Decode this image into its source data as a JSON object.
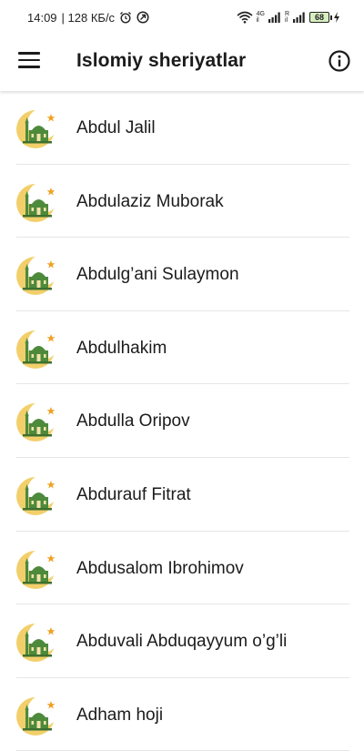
{
  "status_bar": {
    "time": "14:09",
    "network_speed": "| 128 КБ/с",
    "battery_level": "68",
    "signal_1_label_top": "4G",
    "signal_1_label_bottom": "il",
    "signal_2_label_top": "R",
    "signal_2_label_bottom": "il"
  },
  "app_bar": {
    "title": "Islomiy sheriyatlar"
  },
  "colors": {
    "moon": "#f2cf6a",
    "mosque": "#4d8a3c",
    "star": "#f0a020",
    "divider": "#e6e6e6"
  },
  "list": {
    "items": [
      {
        "label": "Abdul Jalil",
        "icon": "mosque-crescent-icon"
      },
      {
        "label": "Abdulaziz Muborak",
        "icon": "mosque-crescent-icon"
      },
      {
        "label": "Abdulg’ani Sulaymon",
        "icon": "mosque-crescent-icon"
      },
      {
        "label": "Abdulhakim",
        "icon": "mosque-crescent-icon"
      },
      {
        "label": "Abdulla Oripov",
        "icon": "mosque-crescent-icon"
      },
      {
        "label": "Abdurauf Fitrat",
        "icon": "mosque-crescent-icon"
      },
      {
        "label": "Abdusalom Ibrohimov",
        "icon": "mosque-crescent-icon"
      },
      {
        "label": "Abduvali Abduqayyum o’g’li",
        "icon": "mosque-crescent-icon"
      },
      {
        "label": "Adham hoji",
        "icon": "mosque-crescent-icon"
      }
    ]
  }
}
